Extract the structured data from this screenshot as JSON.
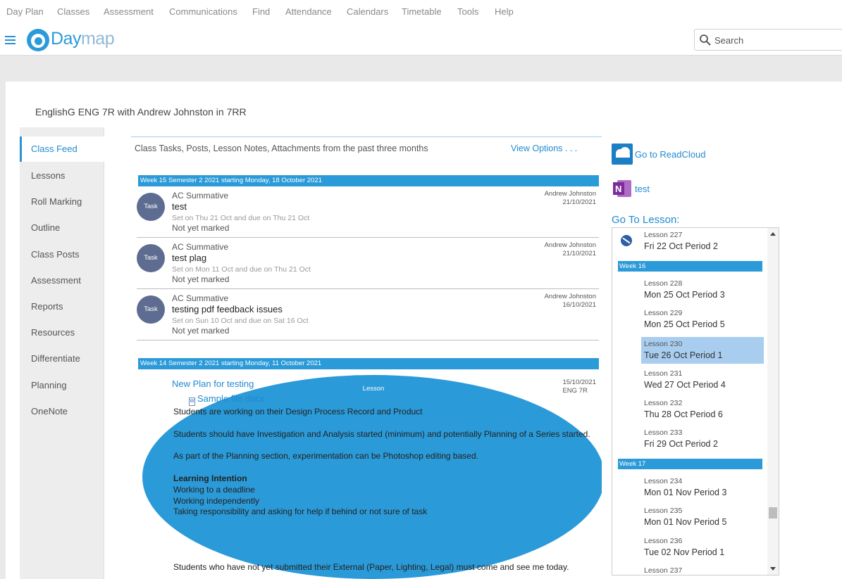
{
  "top_menu": [
    "Day Plan",
    "Classes",
    "Assessment",
    "Communications",
    "Find",
    "Attendance",
    "Calendars",
    "Timetable",
    "Tools",
    "Help"
  ],
  "logo": {
    "day": "Day",
    "map": "map"
  },
  "search": {
    "placeholder": "Search"
  },
  "page_title": "EnglishG ENG 7R with Andrew Johnston in 7RR",
  "sidebar": [
    {
      "label": "Class Feed",
      "active": true
    },
    {
      "label": "Lessons"
    },
    {
      "label": "Roll Marking"
    },
    {
      "label": "Outline"
    },
    {
      "label": "Class Posts"
    },
    {
      "label": "Assessment"
    },
    {
      "label": "Reports"
    },
    {
      "label": "Resources"
    },
    {
      "label": "Differentiate"
    },
    {
      "label": "Planning"
    },
    {
      "label": "OneNote"
    }
  ],
  "feed": {
    "heading": "Class Tasks, Posts, Lesson Notes, Attachments from the past three months",
    "view_options": "View Options . . .",
    "weeks": [
      "Week 15 Semester 2 2021 starting Monday, 18 October 2021",
      "Week 14 Semester 2 2021 starting Monday, 11 October 2021"
    ],
    "tasks": [
      {
        "badge": "Task",
        "type": "AC Summative",
        "name": "test",
        "set": "Set on Thu 21 Oct and due on Thu 21 Oct",
        "status": "Not yet marked",
        "author": "Andrew Johnston",
        "date": "21/10/2021"
      },
      {
        "badge": "Task",
        "type": "AC Summative",
        "name": "test plag",
        "set": "Set on Mon 11 Oct and due on Thu 21 Oct",
        "status": "Not yet marked",
        "author": "Andrew Johnston",
        "date": "21/10/2021"
      },
      {
        "badge": "Task",
        "type": "AC Summative",
        "name": "testing pdf feedback issues",
        "set": "Set on Sun 10 Oct and due on Sat 16 Oct",
        "status": "Not yet marked",
        "author": "Andrew Johnston",
        "date": "16/10/2021"
      }
    ],
    "lesson": {
      "badge": "Lesson",
      "title": "New Plan for testing",
      "file": "Sample file.docx",
      "date": "15/10/2021",
      "class": "ENG 7R",
      "body": [
        "Students are working on their Design Process Record and Product",
        "Students should have Investigation and Analysis started (minimum) and potentially Planning of a Series started.",
        "As part of the Planning section, experimentation can be Photoshop editing based.",
        "Learning Intention",
        "Working to a deadline",
        "Working independently",
        "Taking responsibility and asking for help if behind or not sure of task",
        "Students who have not yet submitted their External (Paper, Lighting, Legal) must come and see me today."
      ]
    }
  },
  "right": {
    "readcloud": "Go to ReadCloud",
    "onenote": "test",
    "go_to_lesson": "Go To Lesson:",
    "lessons": [
      {
        "num": "Lesson 227",
        "when": "Fri 22 Oct Period 2"
      },
      {
        "week": "Week 16"
      },
      {
        "num": "Lesson 228",
        "when": "Mon 25 Oct Period 3"
      },
      {
        "num": "Lesson 229",
        "when": "Mon 25 Oct Period 5"
      },
      {
        "num": "Lesson 230",
        "when": "Tue 26 Oct Period 1",
        "selected": true
      },
      {
        "num": "Lesson 231",
        "when": "Wed 27 Oct Period 4"
      },
      {
        "num": "Lesson 232",
        "when": "Thu 28 Oct Period 6"
      },
      {
        "num": "Lesson 233",
        "when": "Fri 29 Oct Period 2"
      },
      {
        "week": "Week 17"
      },
      {
        "num": "Lesson 234",
        "when": "Mon 01 Nov Period 3"
      },
      {
        "num": "Lesson 235",
        "when": "Mon 01 Nov Period 5"
      },
      {
        "num": "Lesson 236",
        "when": "Tue 02 Nov Period 1"
      },
      {
        "num": "Lesson 237",
        "when": ""
      }
    ]
  },
  "colors": {
    "accent": "#2b9ad8",
    "task_badge": "#5d6c90",
    "selected": "#a8cdef"
  }
}
